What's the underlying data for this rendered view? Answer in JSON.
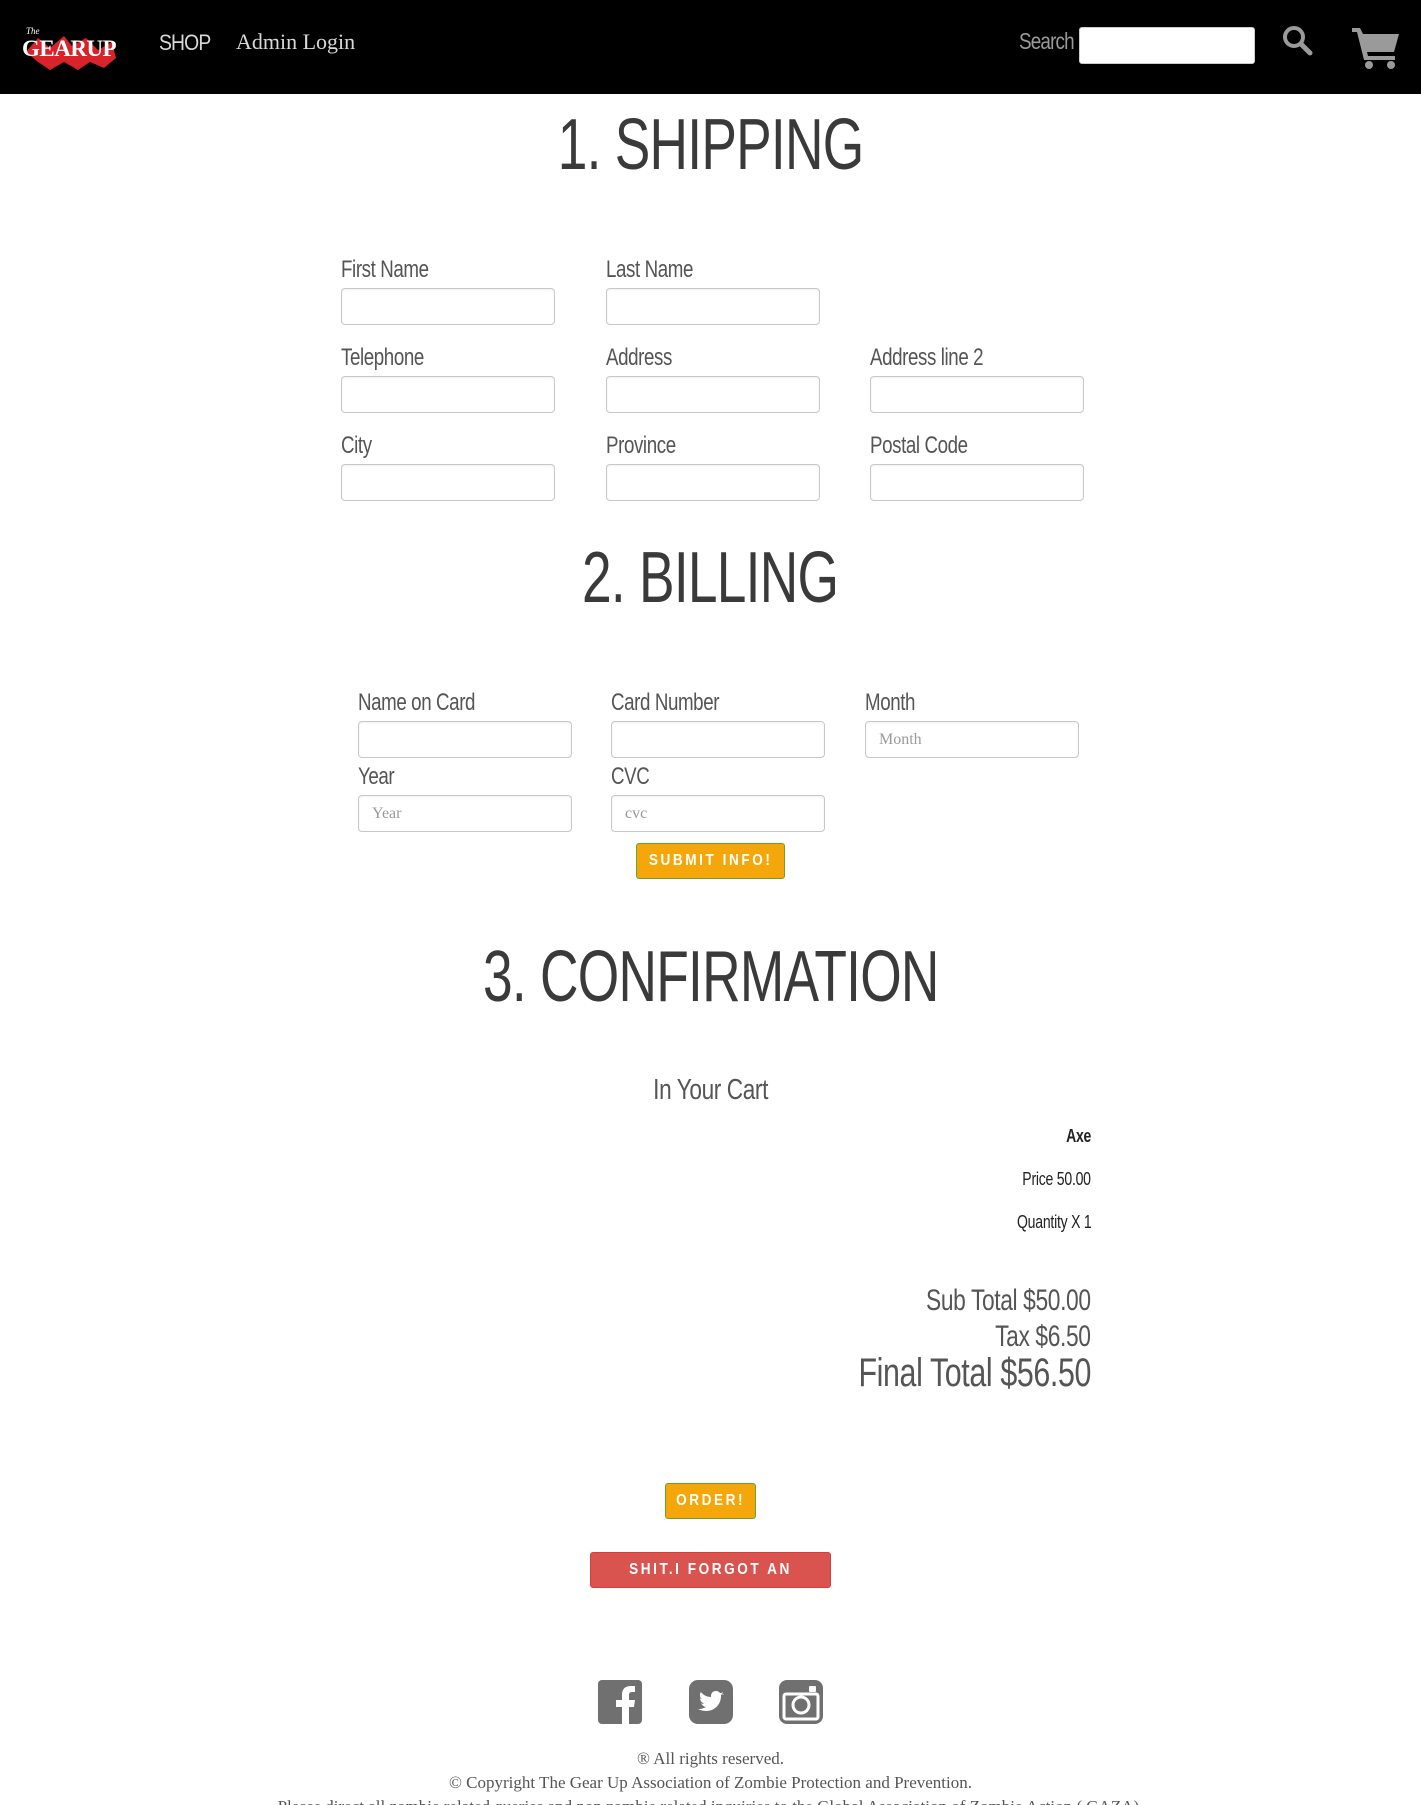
{
  "navbar": {
    "logo_small": "The",
    "logo_main": "GEARUP",
    "shop_label": "SHOP",
    "admin_label": "Admin Login",
    "search_label": "Search",
    "search_value": ""
  },
  "shipping": {
    "heading": "1. SHIPPING",
    "fields": {
      "first_name": {
        "label": "First Name",
        "value": ""
      },
      "last_name": {
        "label": "Last Name",
        "value": ""
      },
      "telephone": {
        "label": "Telephone",
        "value": ""
      },
      "address": {
        "label": "Address",
        "value": ""
      },
      "address2": {
        "label": "Address line 2",
        "value": ""
      },
      "city": {
        "label": "City",
        "value": ""
      },
      "province": {
        "label": "Province",
        "value": ""
      },
      "postal": {
        "label": "Postal Code",
        "value": ""
      }
    }
  },
  "billing": {
    "heading": "2. BILLING",
    "fields": {
      "name_on_card": {
        "label": "Name on Card",
        "value": "",
        "placeholder": ""
      },
      "card_number": {
        "label": "Card Number",
        "value": "",
        "placeholder": ""
      },
      "month": {
        "label": "Month",
        "value": "",
        "placeholder": "Month"
      },
      "year": {
        "label": "Year",
        "value": "",
        "placeholder": "Year"
      },
      "cvc": {
        "label": "CVC",
        "value": "",
        "placeholder": "cvc"
      }
    },
    "submit_label": "SUBMIT INFO!"
  },
  "confirmation": {
    "heading": "3. CONFIRMATION",
    "cart_title": "In Your Cart",
    "item_name": "Axe",
    "item_price": "Price 50.00",
    "item_quantity": "Quantity X 1",
    "sub_total": "Sub Total $50.00",
    "tax": "Tax $6.50",
    "final_total": "Final Total $56.50",
    "order_label": "ORDER!",
    "forgot_label": "SHIT.I FORGOT AN ITEM."
  },
  "footer": {
    "social_icons": [
      "facebook-icon",
      "twitter-icon",
      "instagram-icon"
    ],
    "rights": "® All rights reserved.",
    "copyright": "© Copyright The Gear Up Association of Zombie Protection and Prevention.",
    "contact": "Please direct all zombie related queries and non zombie related inquiries to the Global Association of Zombie Action ( GAZA)."
  },
  "colors": {
    "navbar_bg": "#000000",
    "accent_orange": "#f4a60b",
    "danger_red": "#d9534f",
    "text_dark": "#3a3a3a",
    "icon_gray": "#707070"
  }
}
